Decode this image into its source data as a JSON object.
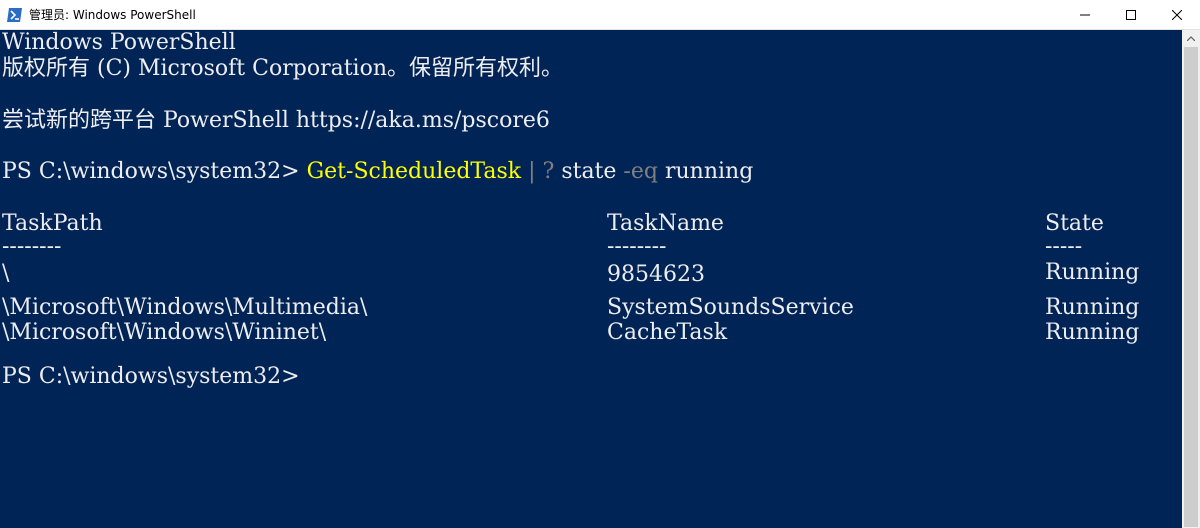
{
  "window": {
    "title": "管理员: Windows PowerShell"
  },
  "console": {
    "banner_line1": "Windows PowerShell",
    "banner_line2": "版权所有 (C) Microsoft Corporation。保留所有权利。",
    "banner_line3": "尝试新的跨平台 PowerShell https://aka.ms/pscore6",
    "prompt1": {
      "prompt": "PS C:\\windows\\system32> ",
      "cmdlet": "Get-ScheduledTask",
      "pipe": " | ? ",
      "property": "state ",
      "operator": "-eq",
      "value": " running"
    },
    "table": {
      "headers": [
        "TaskPath",
        "TaskName",
        "State"
      ],
      "underlines": [
        "--------",
        "--------",
        "-----"
      ],
      "rows": [
        [
          "\\",
          "9854623",
          "Running"
        ],
        [
          "\\Microsoft\\Windows\\Multimedia\\",
          "SystemSoundsService",
          "Running"
        ],
        [
          "\\Microsoft\\Windows\\Wininet\\",
          "CacheTask",
          "Running"
        ]
      ]
    },
    "prompt2": "PS C:\\windows\\system32>"
  },
  "colors": {
    "console_background": "#012456",
    "console_text": "#eeedf0",
    "cmdlet": "#ffff00",
    "operator": "#808080"
  },
  "icons": {
    "app": "powershell-icon",
    "minimize": "minimize-icon",
    "maximize": "maximize-icon",
    "close": "close-icon"
  }
}
